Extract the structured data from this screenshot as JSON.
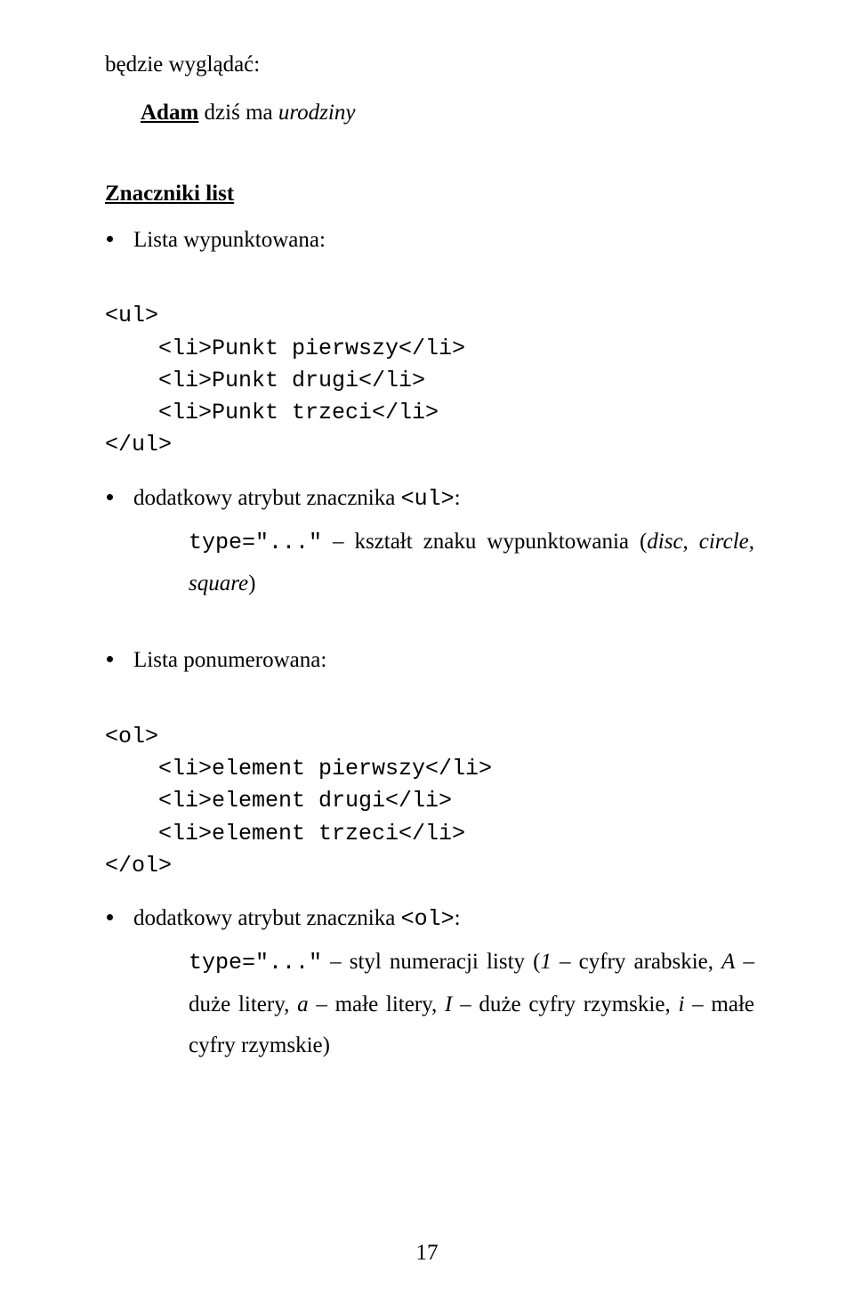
{
  "intro": {
    "line1": "będzie wyglądać:",
    "example_html": "<span class='under'><span class='bold'>Adam</span></span> dziś ma <span class='italic'>urodziny</span>"
  },
  "heading": "Znaczniki list",
  "bullets_ul_label": "Lista wypunktowana:",
  "code_ul": {
    "l1": "<ul>",
    "l2": "<li>Punkt pierwszy</li>",
    "l3": "<li>Punkt drugi</li>",
    "l4": "<li>Punkt trzeci</li>",
    "l5": "</ul>"
  },
  "ul_attr_label_html": "dodatkowy atrybut znacznika <span class='mono'>&lt;ul&gt;</span>:",
  "ul_type_html": "<span class='mono'>type=\"...\"</span> – kształt znaku wypunktowania (<span class='italic'>disc, circle, square</span>)",
  "bullets_ol_label": "Lista ponumerowana:",
  "code_ol": {
    "l1": "<ol>",
    "l2": "<li>element pierwszy</li>",
    "l3": "<li>element drugi</li>",
    "l4": "<li>element trzeci</li>",
    "l5": "</ol>"
  },
  "ol_attr_label_html": "dodatkowy atrybut znacznika <span class='mono'>&lt;ol&gt;</span>:",
  "ol_type_html": "<span class='mono'>type=\"...\"</span> – styl numeracji listy (<span class='italic'>1</span> – cyfry arabskie, <span class='italic'>A</span> – duże litery, <span class='italic'>a</span> – małe litery, <span class='italic'>I</span> – duże cyfry rzymskie, <span class='italic'>i</span> – małe cyfry rzymskie)",
  "page_number": "17"
}
